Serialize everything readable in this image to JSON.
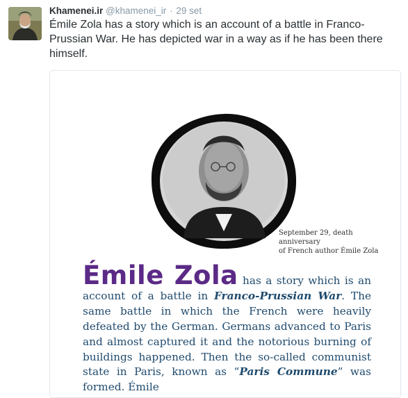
{
  "tweet": {
    "author_name": "Khamenei.ir",
    "handle": "@khamenei_ir",
    "separator": "·",
    "time": "29 set",
    "text": "Émile Zola has a story which is an account of a battle in Franco-Prussian War. He has depicted war in a way as if he has been there himself."
  },
  "image": {
    "caption_line1": "September 29, death anniversary",
    "caption_line2": "of French author Émile Zola",
    "name": "Émile  Zola",
    "p1": " has a story which is an account of a battle in ",
    "em1": "Franco-Prussian War",
    "p2": ". The same battle in which the French were heavily defeated by the German. Germans advanced to Paris and almost captured it and the notorious burning of buildings happened. Then the so-called communist state in Paris, known as “",
    "em2": "Paris Commune",
    "p3": "” was formed. Émile"
  },
  "colors": {
    "name_purple": "#5b2a86",
    "body_blue": "#1f4a6d",
    "muted_gray": "#8899a6"
  }
}
